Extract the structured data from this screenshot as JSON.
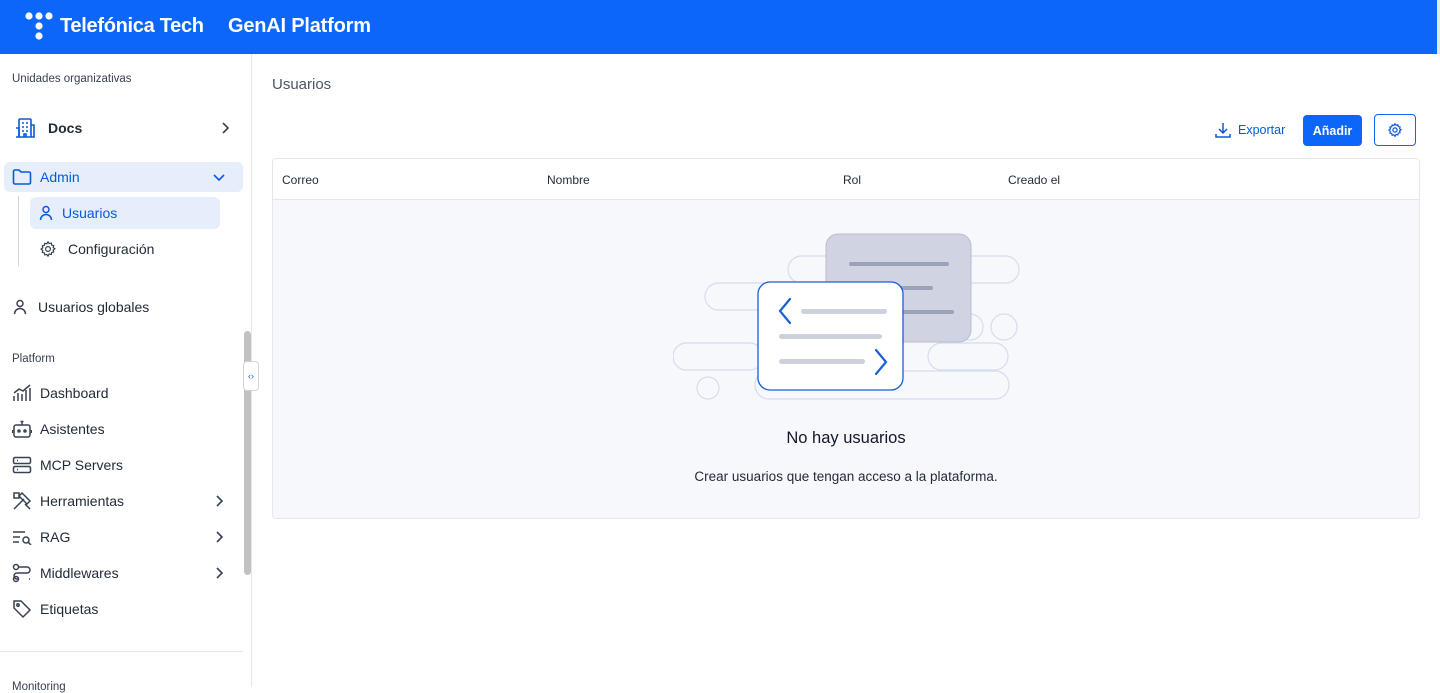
{
  "header": {
    "brand": "Telefónica Tech",
    "product": "GenAI Platform",
    "brand_color": "#0b66f9"
  },
  "sidebar": {
    "org_units_label": "Unidades organizativas",
    "docs_label": "Docs",
    "admin_label": "Admin",
    "admin_children": [
      "Usuarios",
      "Configuración"
    ],
    "global_users_label": "Usuarios globales",
    "platform_label": "Platform",
    "platform_items": [
      "Dashboard",
      "Asistentes",
      "MCP Servers",
      "Herramientas",
      "RAG",
      "Middlewares",
      "Etiquetas"
    ],
    "monitoring_label": "Monitoring",
    "collapse_glyph": "‹›"
  },
  "main": {
    "title": "Usuarios",
    "export_label": "Exportar",
    "add_label": "Añadir",
    "columns": [
      "Correo",
      "Nombre",
      "Rol",
      "Creado el"
    ],
    "empty_title": "No hay usuarios",
    "empty_description": "Crear usuarios que tengan acceso a la plataforma."
  }
}
